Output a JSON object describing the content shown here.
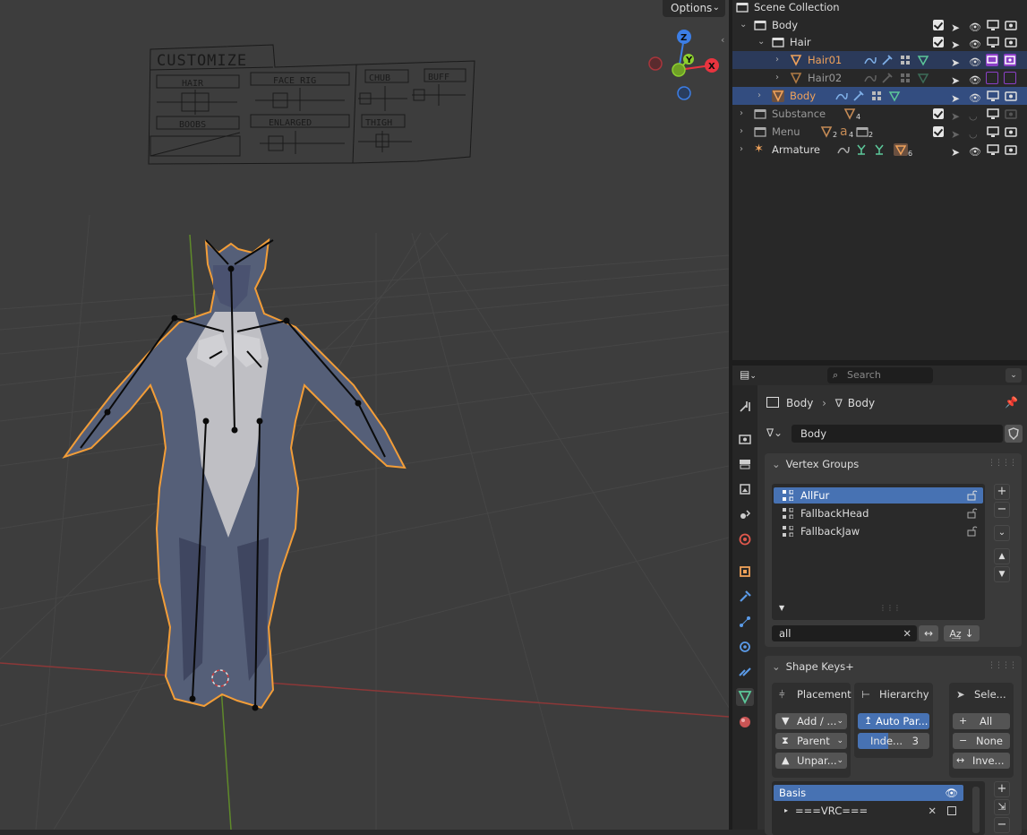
{
  "viewport": {
    "options_label": "Options",
    "menu_card": {
      "title": "CUSTOMIZE",
      "hair": "HAIR",
      "face_rig": "FACE RIG",
      "boobs": "BOOBS",
      "enlarged": "ENLARGED",
      "chub": "CHUB",
      "buff": "BUFF",
      "thigh": "THIGH"
    },
    "gizmo": {
      "z": "Z",
      "y": "Y",
      "x": "X"
    },
    "colors": {
      "axis_x": "#e8343f",
      "axis_y": "#8ccf2f",
      "axis_z": "#3c7ee6",
      "selection_outline": "#f29d38"
    }
  },
  "outliner": {
    "root": "Scene Collection",
    "rows": [
      {
        "label": "Body"
      },
      {
        "label": "Hair"
      },
      {
        "label": "Hair01"
      },
      {
        "label": "Hair02"
      },
      {
        "label": "Body"
      },
      {
        "label": "Substance",
        "sub": "4"
      },
      {
        "label": "Menu",
        "subs": [
          "2",
          "4",
          "2"
        ]
      },
      {
        "label": "Armature",
        "sub": "6"
      }
    ]
  },
  "properties": {
    "search_placeholder": "Search",
    "breadcrumb": {
      "object": "Body",
      "data": "Body"
    },
    "mesh_name": "Body",
    "vertex_groups": {
      "title": "Vertex Groups",
      "items": [
        "AllFur",
        "FallbackHead",
        "FallbackJaw"
      ],
      "filter_value": "all"
    },
    "shape_keys_plus": {
      "title": "Shape Keys+",
      "placement": {
        "title": "Placement",
        "add": "Add / ...",
        "parent": "Parent",
        "unparent": "Unpar..."
      },
      "hierarchy": {
        "title": "Hierarchy",
        "auto_parent": "Auto Par...",
        "indent_label": "Inde...",
        "indent_value": "3"
      },
      "select": {
        "title": "Sele...",
        "all": "All",
        "none": "None",
        "invert": "Inve..."
      },
      "keys": [
        "Basis",
        "===VRC==="
      ]
    }
  }
}
